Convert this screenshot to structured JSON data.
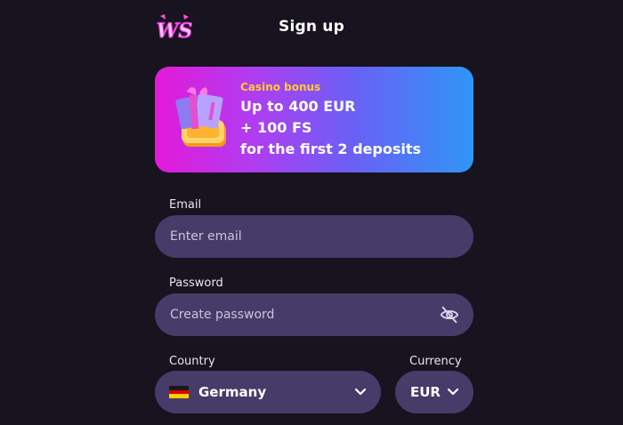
{
  "header": {
    "logo_text": "WS",
    "title": "Sign up"
  },
  "bonus": {
    "tag": "Casino bonus",
    "line1": "Up to 400 EUR",
    "line2": "+ 100 FS",
    "line3": "for the first 2 deposits"
  },
  "form": {
    "email": {
      "label": "Email",
      "placeholder": "Enter email"
    },
    "password": {
      "label": "Password",
      "placeholder": "Create password"
    },
    "country": {
      "label": "Country",
      "value": "Germany"
    },
    "currency": {
      "label": "Currency",
      "value": "EUR"
    }
  },
  "colors": {
    "background": "#17131f",
    "field": "#473b69",
    "bonus_tag": "#ffcb2e"
  },
  "icons": {
    "password_toggle": "eye-off-icon",
    "dropdown": "chevron-down-icon",
    "country_flag": "germany-flag-icon"
  }
}
